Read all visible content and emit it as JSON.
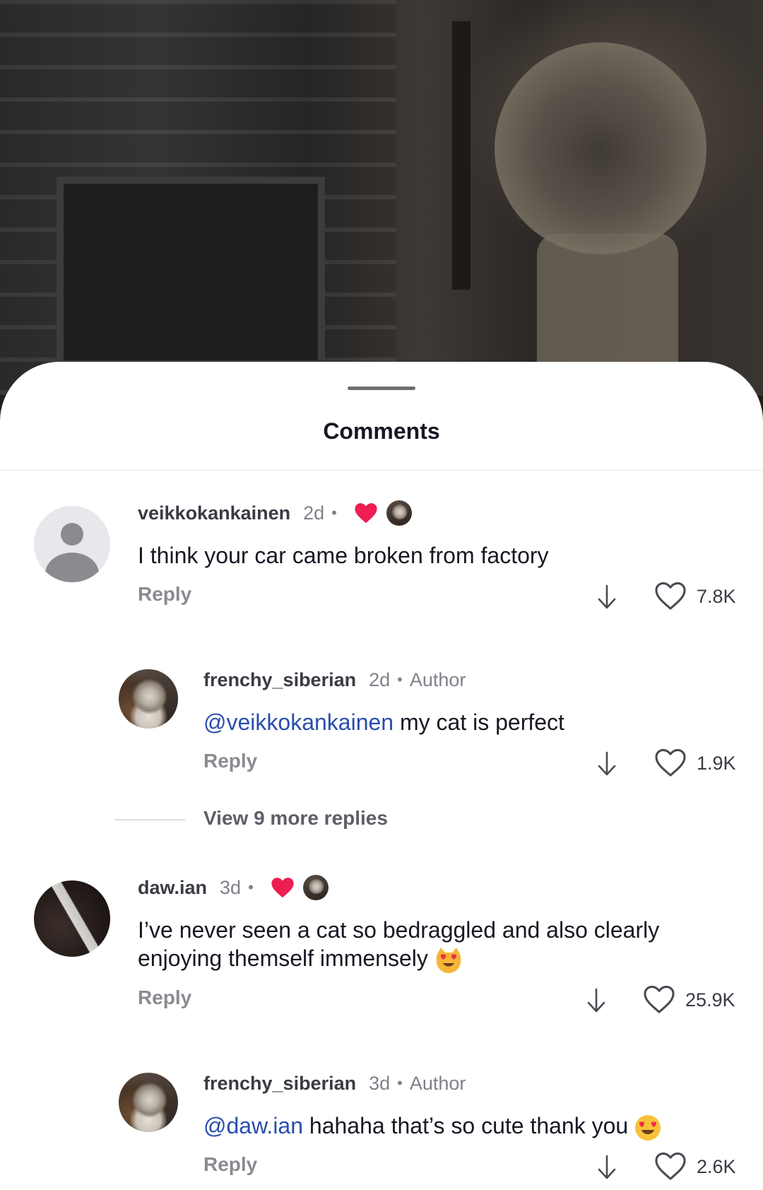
{
  "sheet": {
    "title": "Comments"
  },
  "comments": [
    {
      "username": "veikkokankainen",
      "time": "2d",
      "liked_by_creator": true,
      "avatar": "default-avatar",
      "text": "I think your car came broken from factory",
      "reply_label": "Reply",
      "likes": "7.8K"
    },
    {
      "username": "frenchy_siberian",
      "time": "2d",
      "tag": "Author",
      "avatar": "cat-avatar",
      "mention": "@veikkokankainen",
      "text": "my cat is perfect",
      "reply_label": "Reply",
      "likes": "1.9K"
    },
    {
      "username": "daw.ian",
      "time": "3d",
      "liked_by_creator": true,
      "avatar": "photo-avatar",
      "text_line1": "I’ve never seen a cat so bedraggled and also clearly",
      "text_line2": "enjoying themself immensely",
      "emoji": "heart-eyes-cat-emoji",
      "reply_label": "Reply",
      "likes": "25.9K"
    },
    {
      "username": "frenchy_siberian",
      "time": "3d",
      "tag": "Author",
      "avatar": "cat-avatar",
      "mention": "@daw.ian",
      "text": "hahaha that’s so cute thank you",
      "emoji": "heart-eyes-emoji",
      "reply_label": "Reply",
      "likes": "2.6K"
    }
  ],
  "view_more": {
    "label": "View 9 more replies"
  },
  "colors": {
    "liked_heart": "#ee1d52",
    "mention": "#2b4eab",
    "text": "#161823",
    "muted": "#80818a"
  }
}
